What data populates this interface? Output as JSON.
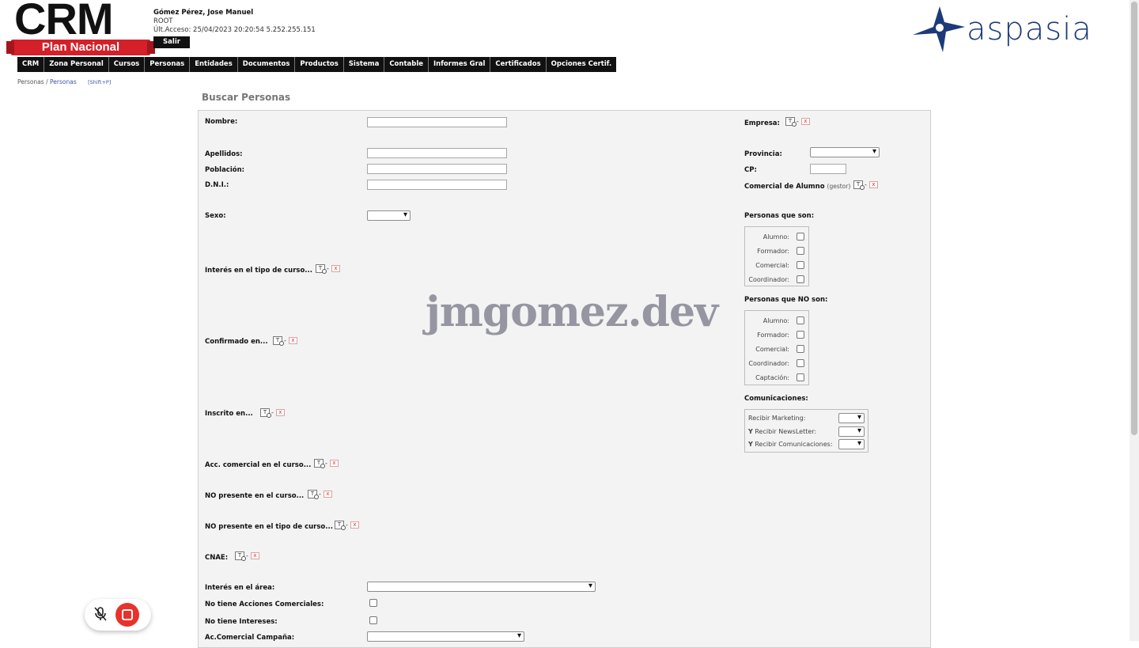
{
  "logo": {
    "crm_text": "CRM",
    "banner_text": "Plan Nacional",
    "brand_text": "aspasia"
  },
  "user": {
    "name": "Gómez Pérez, Jose Manuel",
    "role": "ROOT",
    "last_access": "Últ.Acceso: 25/04/2023 20:20:54 5.252.255.151",
    "logout_label": "Salir"
  },
  "nav": {
    "items": [
      "CRM",
      "Zona Personal",
      "Cursos",
      "Personas",
      "Entidades",
      "Documentos",
      "Productos",
      "Sistema",
      "Contable",
      "Informes Gral",
      "Certificados",
      "Opciones Certif."
    ]
  },
  "breadcrumb": {
    "root": "Personas",
    "separator": "/",
    "current": "Personas",
    "shortcut": "[Shift+P]"
  },
  "watermark": "jmgomez.dev",
  "page_title": "Buscar Personas",
  "form": {
    "nombre": "Nombre:",
    "apellidos": "Apellidos:",
    "poblacion": "Población:",
    "dni": "D.N.I.:",
    "sexo": "Sexo:",
    "interes_tipo": "Interés en el tipo de curso...",
    "confirmado": "Confirmado en...",
    "inscrito": "Inscrito en...",
    "acc_comercial": "Acc. comercial en el curso...",
    "no_presente_curso": "NO presente en el curso...",
    "no_presente_tipo": "NO presente en el tipo de curso...",
    "cnae": "CNAE:",
    "interes_area": "Interés en el área:",
    "no_acciones": "No tiene Acciones Comerciales:",
    "no_intereses": "No tiene Intereses:",
    "campana": "Ac.Comercial Campaña:",
    "empresa": "Empresa:",
    "provincia": "Provincia:",
    "cp": "CP:",
    "comercial_alumno": "Comercial de Alumno",
    "comercial_alumno_note": "(gestor)",
    "personas_son": "Personas que son:",
    "personas_no_son": "Personas que NO son:",
    "comunicaciones": "Comunicaciones:"
  },
  "picker": {
    "dash": "-",
    "clear": "x",
    "pick": "T"
  },
  "personas_son_options": [
    "Alumno:",
    "Formador:",
    "Comercial:",
    "Coordinador:"
  ],
  "personas_no_son_options": [
    "Alumno:",
    "Formador:",
    "Comercial:",
    "Coordinador:",
    "Captación:"
  ],
  "comunicaciones_rows": [
    {
      "prefix": "",
      "label": "Recibir Marketing:"
    },
    {
      "prefix": "Y",
      "label": "Recibir NewsLetter:"
    },
    {
      "prefix": "Y",
      "label": "Recibir Comunicaciones:"
    }
  ],
  "icons": {
    "mic": "mic-off-icon",
    "record": "stop-record-icon"
  },
  "colors": {
    "nav_bg": "#111111",
    "crm_red": "#d32029",
    "aspasia_blue": "#1d3a78",
    "record_red": "#e8322c"
  }
}
